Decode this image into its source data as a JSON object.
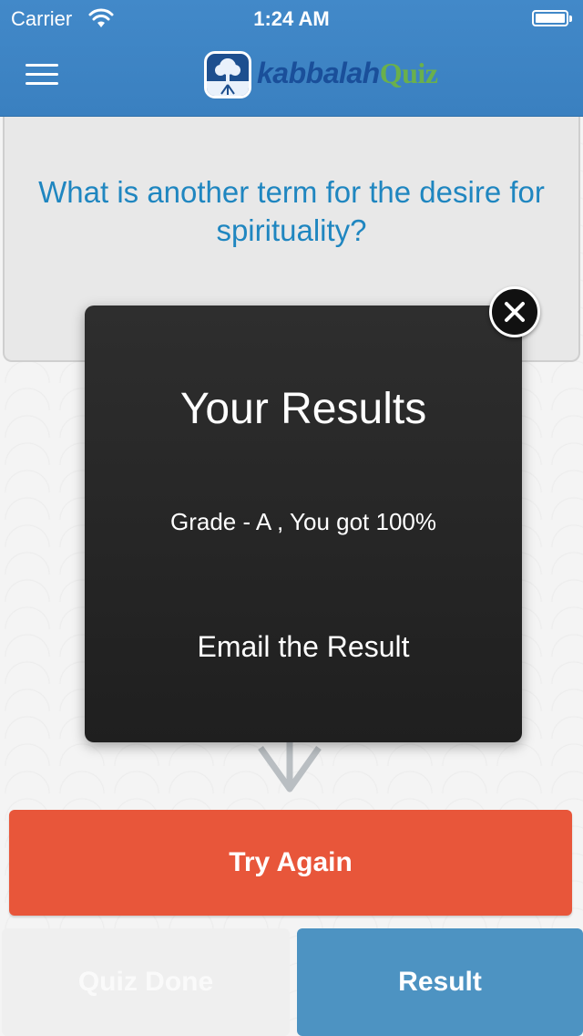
{
  "status_bar": {
    "carrier": "Carrier",
    "time": "1:24 AM",
    "icons": [
      "wifi-icon",
      "battery-icon"
    ]
  },
  "nav": {
    "menu_icon": "hamburger-menu-icon",
    "logo": {
      "word1": "kabbalah",
      "word2": "Quiz",
      "icon": "tree-logo-icon"
    }
  },
  "question": {
    "text": "What is another term for the desire for spirituality?"
  },
  "results_popup": {
    "title": "Your Results",
    "grade_line": "Grade - A , You got 100%",
    "email_label": "Email the Result",
    "close_icon": "close-icon"
  },
  "buttons": {
    "try_again": "Try Again",
    "quiz_done": "Quiz Done",
    "result": "Result"
  },
  "colors": {
    "nav_blue": "#3d85c6",
    "question_blue": "#1f86c0",
    "try_again_orange": "#e8563a",
    "result_blue": "#4d93c2",
    "popup_dark": "#262626"
  }
}
